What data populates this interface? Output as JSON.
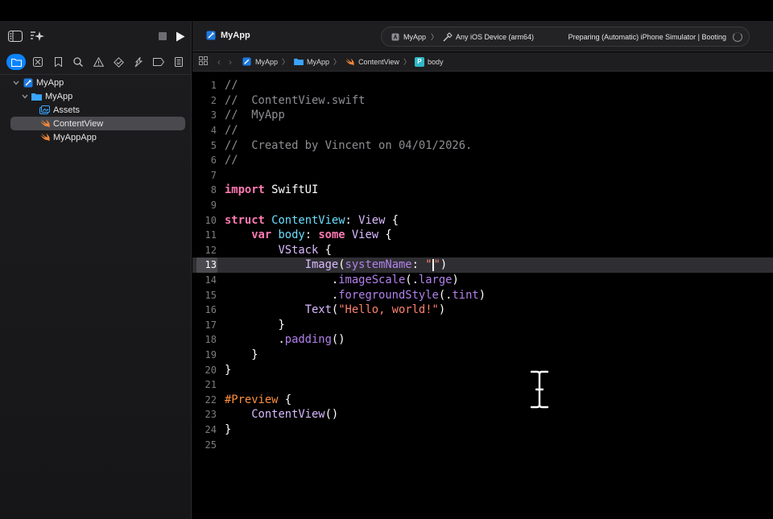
{
  "project": {
    "name": "MyApp"
  },
  "navigator": {
    "tree": [
      {
        "label": "MyApp",
        "kind": "project",
        "depth": 0,
        "expanded": true
      },
      {
        "label": "MyApp",
        "kind": "folder",
        "depth": 1,
        "expanded": true
      },
      {
        "label": "Assets",
        "kind": "assets",
        "depth": 2
      },
      {
        "label": "ContentView",
        "kind": "swift",
        "depth": 2,
        "selected": true
      },
      {
        "label": "MyAppApp",
        "kind": "swift",
        "depth": 2
      }
    ]
  },
  "toolbar": {
    "scheme": "MyApp",
    "destination": "Any iOS Device (arm64)",
    "status": "Preparing (Automatic) iPhone Simulator | Booting"
  },
  "jumpbar": {
    "items": [
      {
        "label": "MyApp",
        "icon": "project-icon"
      },
      {
        "label": "MyApp",
        "icon": "folder-icon"
      },
      {
        "label": "ContentView",
        "icon": "swift-icon"
      },
      {
        "label": "body",
        "icon": "property-icon",
        "badge": "P"
      }
    ]
  },
  "editor": {
    "current_line": 13,
    "lines": [
      [
        [
          "cm",
          "//"
        ]
      ],
      [
        [
          "cm",
          "//  ContentView.swift"
        ]
      ],
      [
        [
          "cm",
          "//  MyApp"
        ]
      ],
      [
        [
          "cm",
          "//"
        ]
      ],
      [
        [
          "cm",
          "//  Created by Vincent on 04/01/2026."
        ]
      ],
      [
        [
          "cm",
          "//"
        ]
      ],
      [],
      [
        [
          "kw",
          "import"
        ],
        [
          "",
          " SwiftUI"
        ]
      ],
      [],
      [
        [
          "kw",
          "struct"
        ],
        [
          "",
          " "
        ],
        [
          "nm",
          "ContentView"
        ],
        [
          "",
          ": "
        ],
        [
          "ty",
          "View"
        ],
        [
          "",
          " {"
        ]
      ],
      [
        [
          "",
          "    "
        ],
        [
          "kw",
          "var"
        ],
        [
          "",
          " "
        ],
        [
          "nm",
          "body"
        ],
        [
          "",
          ": "
        ],
        [
          "kw",
          "some"
        ],
        [
          "",
          " "
        ],
        [
          "ty",
          "View"
        ],
        [
          "",
          " {"
        ]
      ],
      [
        [
          "",
          "        "
        ],
        [
          "ty",
          "VStack"
        ],
        [
          "",
          " {"
        ]
      ],
      [
        [
          "",
          "            "
        ],
        [
          "ty",
          "Image"
        ],
        [
          "",
          "("
        ],
        [
          "fn",
          "systemName"
        ],
        [
          "",
          ": "
        ],
        [
          "str",
          "\""
        ],
        [
          "caret",
          ""
        ],
        [
          "str",
          "\""
        ],
        [
          "",
          ")"
        ]
      ],
      [
        [
          "",
          "                ."
        ],
        [
          "fn",
          "imageScale"
        ],
        [
          "",
          "(."
        ],
        [
          "fn",
          "large"
        ],
        [
          "",
          ")"
        ]
      ],
      [
        [
          "",
          "                ."
        ],
        [
          "fn",
          "foregroundStyle"
        ],
        [
          "",
          "(."
        ],
        [
          "fn",
          "tint"
        ],
        [
          "",
          ")"
        ]
      ],
      [
        [
          "",
          "            "
        ],
        [
          "ty",
          "Text"
        ],
        [
          "",
          "("
        ],
        [
          "str",
          "\"Hello, world!\""
        ],
        [
          "",
          ")"
        ]
      ],
      [
        [
          "",
          "        }"
        ]
      ],
      [
        [
          "",
          "        ."
        ],
        [
          "fn",
          "padding"
        ],
        [
          "",
          "()"
        ]
      ],
      [
        [
          "",
          "    }"
        ]
      ],
      [
        [
          "",
          "}"
        ]
      ],
      [],
      [
        [
          "pp",
          "#Preview"
        ],
        [
          "",
          " {"
        ]
      ],
      [
        [
          "",
          "    "
        ],
        [
          "ty",
          "ContentView"
        ],
        [
          "",
          "()"
        ]
      ],
      [
        [
          "",
          "}"
        ]
      ],
      []
    ]
  }
}
